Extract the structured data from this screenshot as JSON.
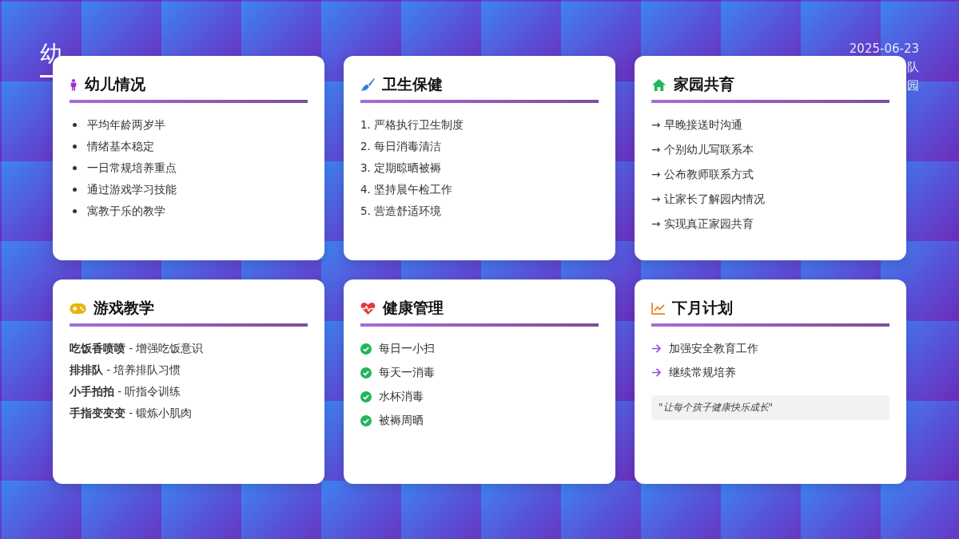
{
  "header": {
    "title": "幼",
    "date": "2025-06-23",
    "meta_lines": [
      "队",
      "园"
    ]
  },
  "cards": [
    {
      "title": "幼儿情况",
      "kind": "bullets",
      "items": [
        "平均年龄两岁半",
        "情绪基本稳定",
        "一日常规培养重点",
        "通过游戏学习技能",
        "寓教于乐的教学"
      ]
    },
    {
      "title": "卫生保健",
      "kind": "numbered",
      "items": [
        "1. 严格执行卫生制度",
        "2. 每日消毒清洁",
        "3. 定期晾晒被褥",
        "4. 坚持晨午检工作",
        "5. 营造舒适环境"
      ]
    },
    {
      "title": "家园共育",
      "kind": "arrows",
      "items": [
        "→ 早晚接送时沟通",
        "→ 个别幼儿写联系本",
        "→ 公布教师联系方式",
        "→ 让家长了解园内情况",
        "→ 实现真正家园共育"
      ]
    },
    {
      "title": "游戏教学",
      "kind": "games",
      "items": [
        "**吃饭香喷喷** - 增强吃饭意识",
        "**排排队** - 培养排队习惯",
        "**小手拍拍** - 听指令训练",
        "**手指变变变** - 锻炼小肌肉"
      ]
    },
    {
      "title": "健康管理",
      "kind": "checks",
      "items": [
        "每日一小扫",
        "每天一消毒",
        "水杯消毒",
        "被褥周晒"
      ]
    },
    {
      "title": "下月计划",
      "kind": "plan",
      "items": [
        "加强安全教育工作",
        "继续常规培养"
      ],
      "quote": "\"让每个孩子健康快乐成长\""
    }
  ]
}
